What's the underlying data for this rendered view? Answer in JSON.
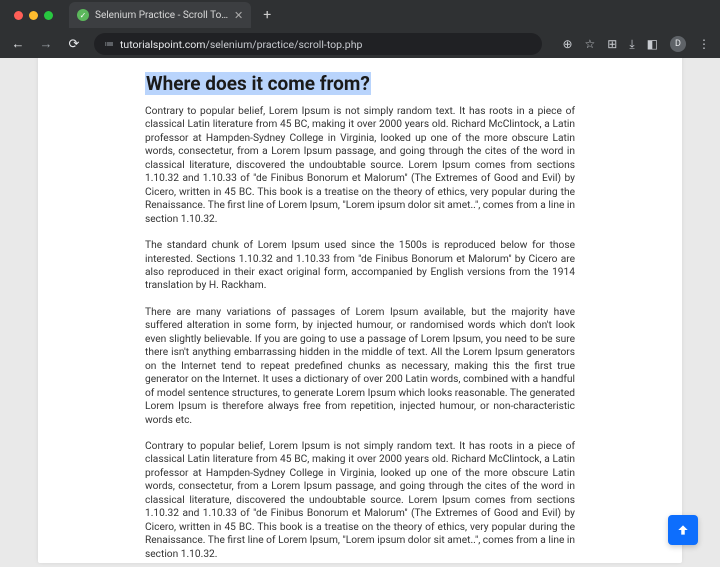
{
  "browser": {
    "tab_title": "Selenium Practice - Scroll To…",
    "url_host": "tutorialspoint.com",
    "url_path": "/selenium/practice/scroll-top.php",
    "avatar_initial": "D"
  },
  "page": {
    "heading": "Where does it come from?",
    "paragraphs": [
      "Contrary to popular belief, Lorem Ipsum is not simply random text. It has roots in a piece of classical Latin literature from 45 BC, making it over 2000 years old. Richard McClintock, a Latin professor at Hampden-Sydney College in Virginia, looked up one of the more obscure Latin words, consectetur, from a Lorem Ipsum passage, and going through the cites of the word in classical literature, discovered the undoubtable source. Lorem Ipsum comes from sections 1.10.32 and 1.10.33 of \"de Finibus Bonorum et Malorum\" (The Extremes of Good and Evil) by Cicero, written in 45 BC. This book is a treatise on the theory of ethics, very popular during the Renaissance. The first line of Lorem Ipsum, \"Lorem ipsum dolor sit amet..\", comes from a line in section 1.10.32.",
      "The standard chunk of Lorem Ipsum used since the 1500s is reproduced below for those interested. Sections 1.10.32 and 1.10.33 from \"de Finibus Bonorum et Malorum\" by Cicero are also reproduced in their exact original form, accompanied by English versions from the 1914 translation by H. Rackham.",
      "There are many variations of passages of Lorem Ipsum available, but the majority have suffered alteration in some form, by injected humour, or randomised words which don't look even slightly believable. If you are going to use a passage of Lorem Ipsum, you need to be sure there isn't anything embarrassing hidden in the middle of text. All the Lorem Ipsum generators on the Internet tend to repeat predefined chunks as necessary, making this the first true generator on the Internet. It uses a dictionary of over 200 Latin words, combined with a handful of model sentence structures, to generate Lorem Ipsum which looks reasonable. The generated Lorem Ipsum is therefore always free from repetition, injected humour, or non-characteristic words etc.",
      "Contrary to popular belief, Lorem Ipsum is not simply random text. It has roots in a piece of classical Latin literature from 45 BC, making it over 2000 years old. Richard McClintock, a Latin professor at Hampden-Sydney College in Virginia, looked up one of the more obscure Latin words, consectetur, from a Lorem Ipsum passage, and going through the cites of the word in classical literature, discovered the undoubtable source. Lorem Ipsum comes from sections 1.10.32 and 1.10.33 of \"de Finibus Bonorum et Malorum\" (The Extremes of Good and Evil) by Cicero, written in 45 BC. This book is a treatise on the theory of ethics, very popular during the Renaissance. The first line of Lorem Ipsum, \"Lorem ipsum dolor sit amet..\", comes from a line in section 1.10.32."
    ]
  }
}
